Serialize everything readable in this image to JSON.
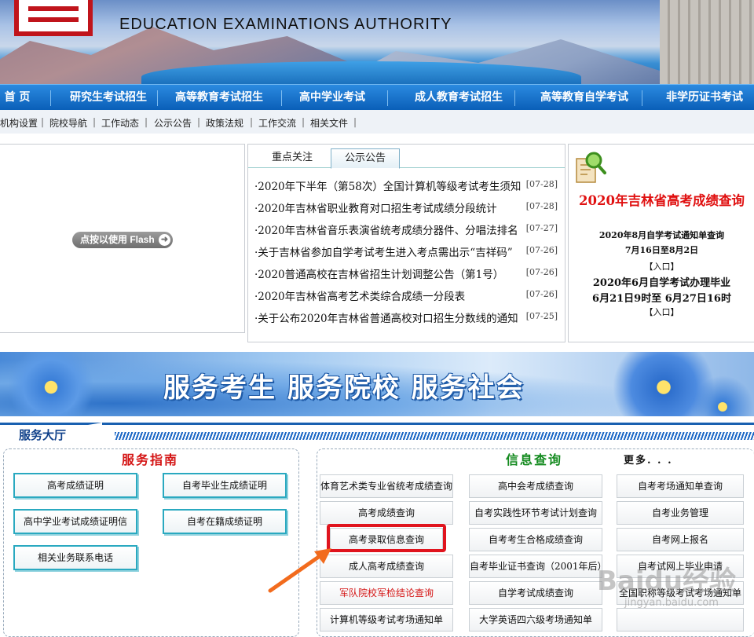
{
  "header": {
    "site_title": "EDUCATION EXAMINATIONS AUTHORITY"
  },
  "nav": [
    "首 页",
    "研究生考试招生",
    "高等教育考试招生",
    "高中学业考试",
    "成人教育考试招生",
    "高等教育自学考试",
    "非学历证书考试"
  ],
  "subnav": [
    "机构设置",
    "院校导航",
    "工作动态",
    "公示公告",
    "政策法规",
    "工作交流",
    "相关文件"
  ],
  "subnav_sep": "|",
  "flash": {
    "button": "点按以使用 Flash",
    "arrow": "➜"
  },
  "news": {
    "tabs": [
      "重点关注",
      "公示公告"
    ],
    "items": [
      {
        "title": "·2020年下半年（第58次）全国计算机等级考试考生须知",
        "date": "[07-28]"
      },
      {
        "title": "·2020年吉林省职业教育对口招生考试成绩分段统计",
        "date": "[07-28]"
      },
      {
        "title": "·2020年吉林省音乐表演省统考成绩分器件、分唱法排名",
        "date": "[07-27]"
      },
      {
        "title": "·关于吉林省参加自学考试考生进入考点需出示“吉祥码”",
        "date": "[07-26]"
      },
      {
        "title": "·2020普通高校在吉林省招生计划调整公告（第1号）",
        "date": "[07-26]"
      },
      {
        "title": "·2020年吉林省高考艺术类综合成绩一分段表",
        "date": "[07-26]"
      },
      {
        "title": "·关于公布2020年吉林省普通高校对口招生分数线的通知",
        "date": "[07-25]"
      }
    ]
  },
  "score": {
    "title": "2020年吉林省高考成绩查询",
    "line1": "2020年8月自学考试通知单查询",
    "line2": "7月16日至8月2日",
    "entry1": "【入口】",
    "line3": "2020年6月自学考试办理毕业",
    "line4": "6月21日9时至 6月27日16时",
    "entry2": "【入口】"
  },
  "banner": {
    "text": "服务考生 服务院校 服务社会"
  },
  "hall": {
    "title": "服务大厅",
    "guide_head": "服务指南",
    "query_head": "信息查询",
    "more": "更多. . .",
    "guide_buttons": [
      "高考成绩证明",
      "自考毕业生成绩证明",
      "高中学业考试成绩证明信",
      "自考在籍成绩证明",
      "相关业务联系电话"
    ],
    "query_col1": [
      "体育艺术类专业省统考成绩查询",
      "高考成绩查询",
      "高考录取信息查询",
      "成人高考成绩查询",
      "军队院校军检结论查询",
      "计算机等级考试考场通知单"
    ],
    "query_col2": [
      "高中会考成绩查询",
      "自考实践性环节考试计划查询",
      "自考考生合格成绩查询",
      "自考毕业证书查询（2001年后）",
      "自学考试成绩查询",
      "大学英语四六级考场通知单"
    ],
    "query_col3": [
      "自考考场通知单查询",
      "自考业务管理",
      "自考网上报名",
      "自考试网上毕业申请",
      "全国职称等级考试考场通知单",
      ""
    ]
  },
  "watermark": {
    "text": "Baidu经验",
    "sub": "jingyan.baidu.com"
  },
  "colors": {
    "nav_blue": "#0a5fb8",
    "accent_red": "#e01010",
    "guide_green": "#138a1e",
    "highlight": "#e0141e",
    "arrow": "#f26b1d"
  }
}
